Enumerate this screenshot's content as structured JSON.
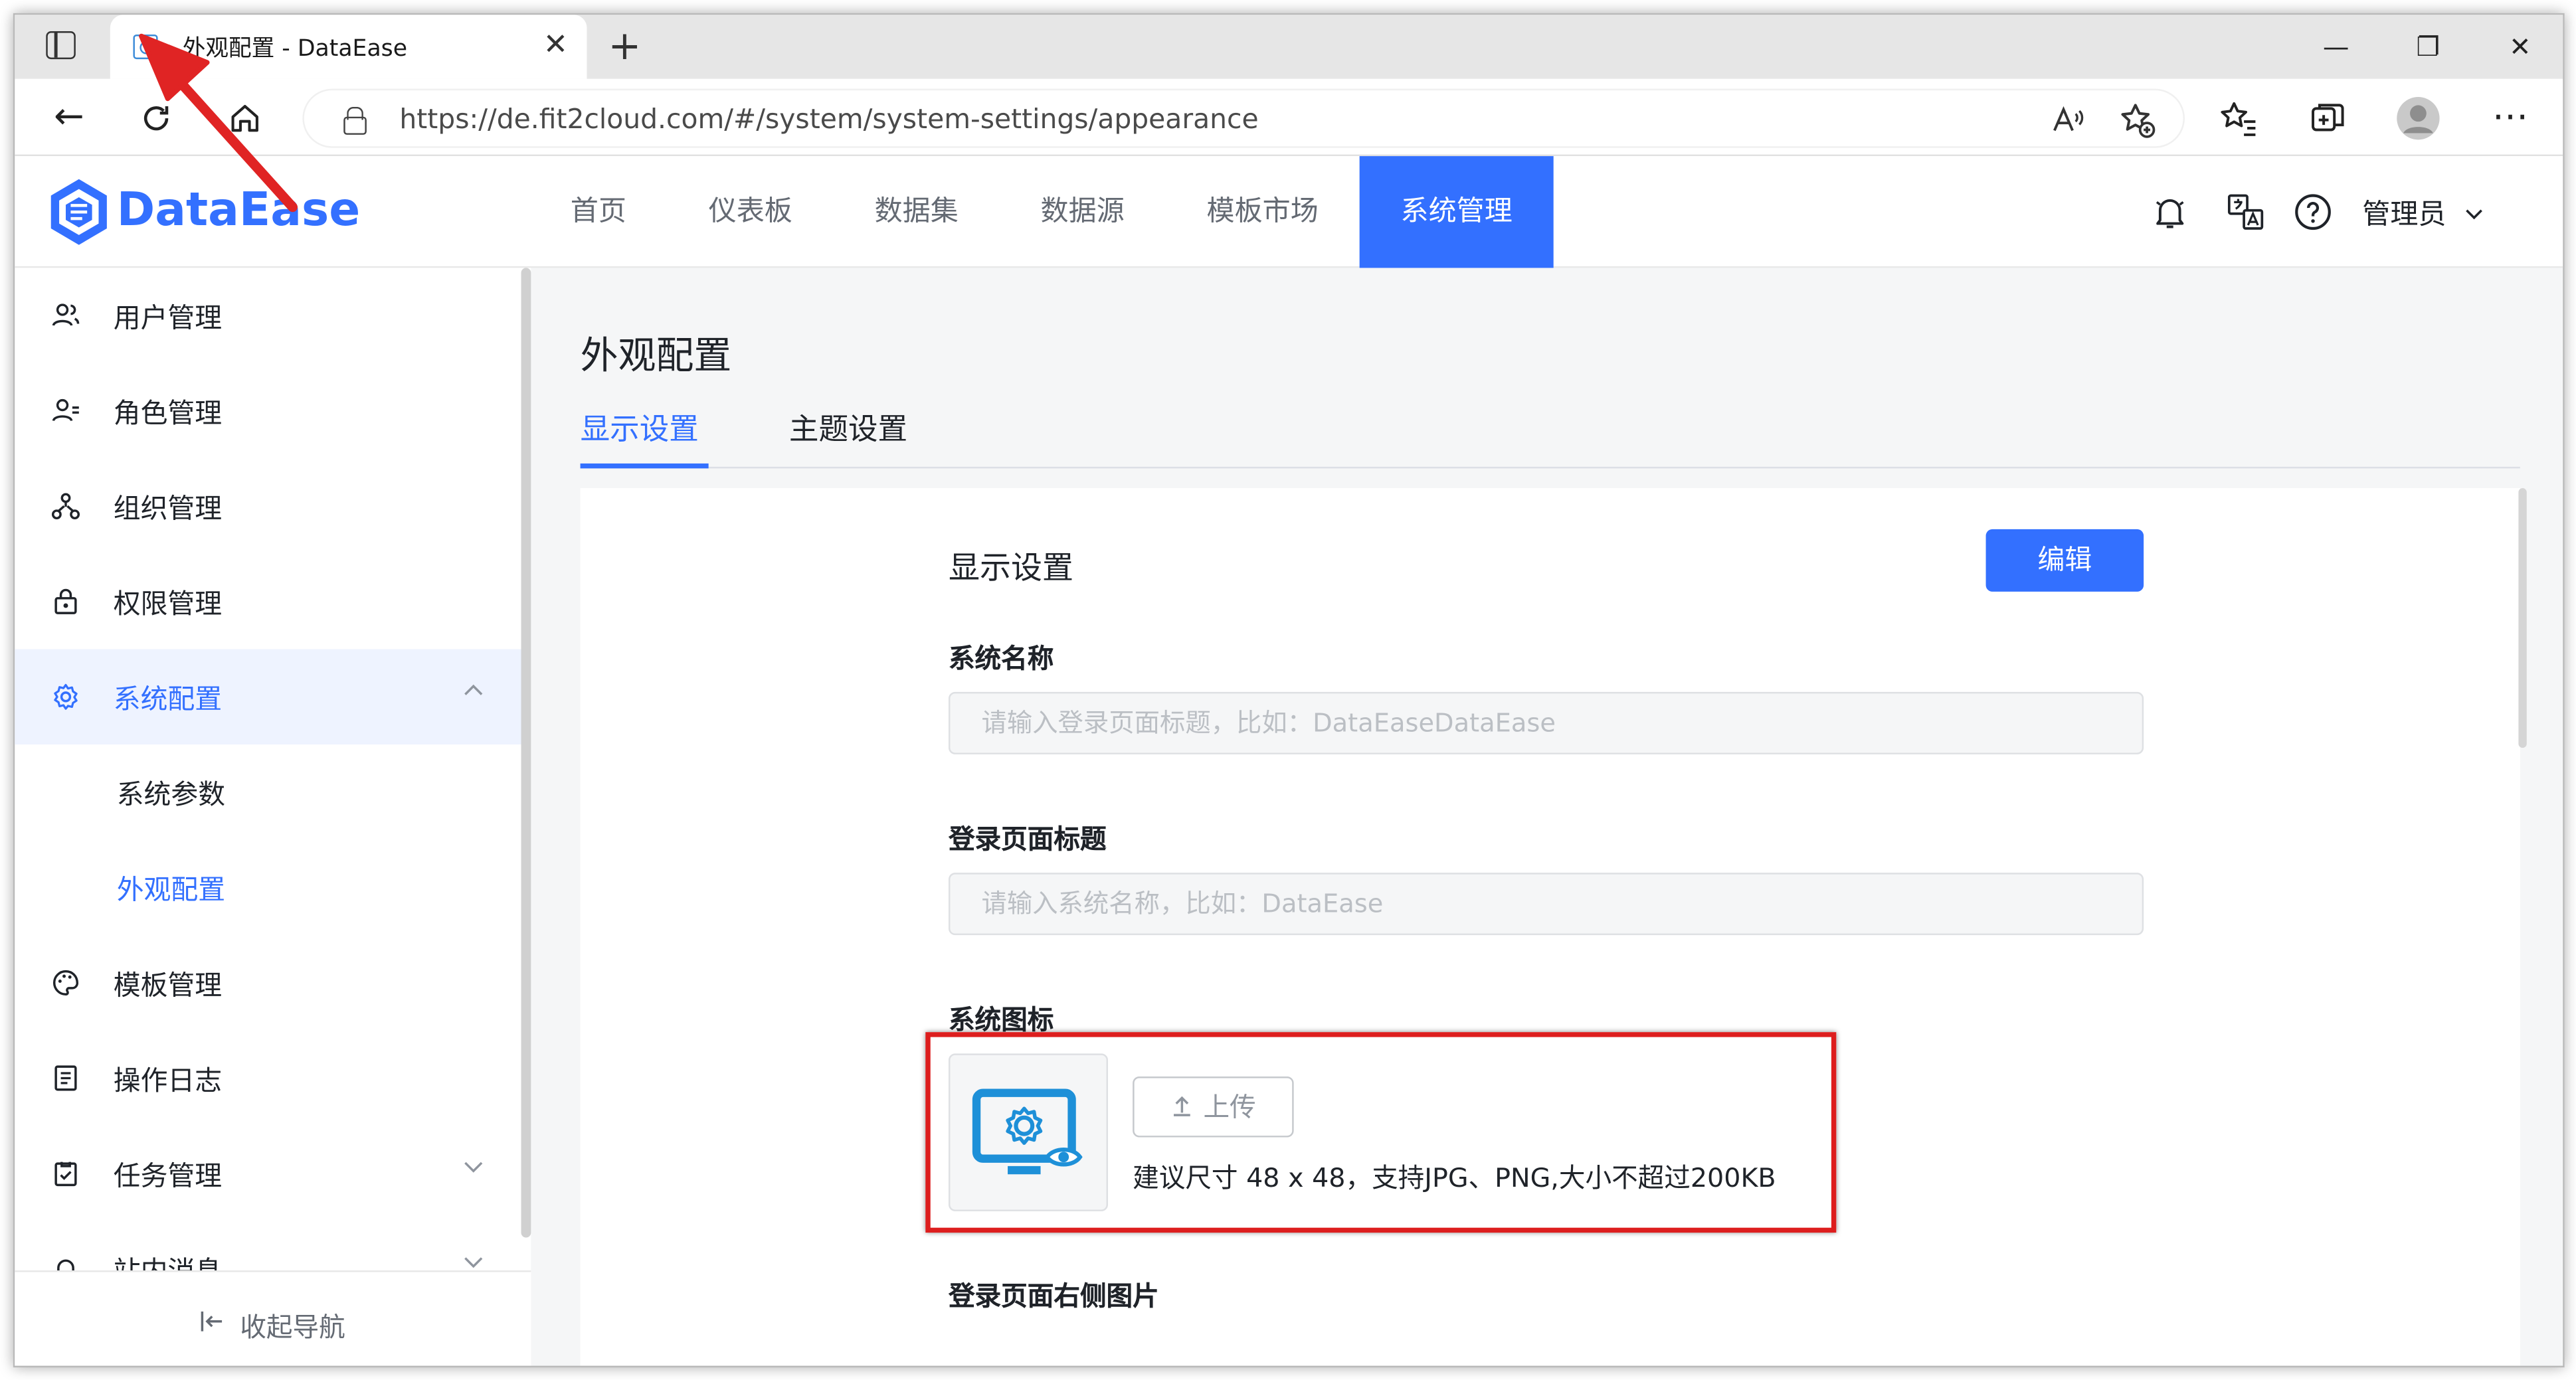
{
  "browser": {
    "tab_title": "外观配置 - DataEase",
    "tab_close": "✕",
    "new_tab": "+",
    "minimize": "—",
    "maximize": "❐",
    "close": "✕",
    "url": "https://de.fit2cloud.com/#/system/system-settings/appearance",
    "back": "←",
    "more": "⋯"
  },
  "header": {
    "logo_text": "DataEase",
    "nav": [
      "首页",
      "仪表板",
      "数据集",
      "数据源",
      "模板市场",
      "系统管理"
    ],
    "active_nav": "系统管理",
    "user_name": "管理员"
  },
  "sidebar": {
    "items": [
      {
        "label": "用户管理",
        "icon": "user-group-icon"
      },
      {
        "label": "角色管理",
        "icon": "role-icon"
      },
      {
        "label": "组织管理",
        "icon": "org-tree-icon"
      },
      {
        "label": "权限管理",
        "icon": "lock-icon"
      },
      {
        "label": "系统配置",
        "icon": "gear-icon",
        "expanded": true
      },
      {
        "label": "系统参数",
        "sub": true
      },
      {
        "label": "外观配置",
        "sub": true,
        "active": true
      },
      {
        "label": "模板管理",
        "icon": "palette-icon"
      },
      {
        "label": "操作日志",
        "icon": "log-icon"
      },
      {
        "label": "任务管理",
        "icon": "task-icon"
      },
      {
        "label": "站内消息",
        "icon": "bell-icon"
      }
    ],
    "collapse_label": "收起导航"
  },
  "main": {
    "page_title": "外观配置",
    "tabs": [
      "显示设置",
      "主题设置"
    ],
    "active_tab": "显示设置",
    "section_title": "显示设置",
    "edit_label": "编辑",
    "fields": {
      "system_name_label": "系统名称",
      "system_name_placeholder": "请输入登录页面标题，比如：DataEaseDataEase",
      "login_title_label": "登录页面标题",
      "login_title_placeholder": "请输入系统名称，比如：DataEase",
      "system_icon_label": "系统图标",
      "upload_label": "上传",
      "upload_hint": "建议尺寸 48 x 48，支持JPG、PNG,大小不超过200KB",
      "login_image_label": "登录页面右侧图片"
    }
  },
  "colors": {
    "accent": "#3370ff",
    "highlight_box": "#dd1e1e",
    "annotation_arrow": "#e02424"
  }
}
